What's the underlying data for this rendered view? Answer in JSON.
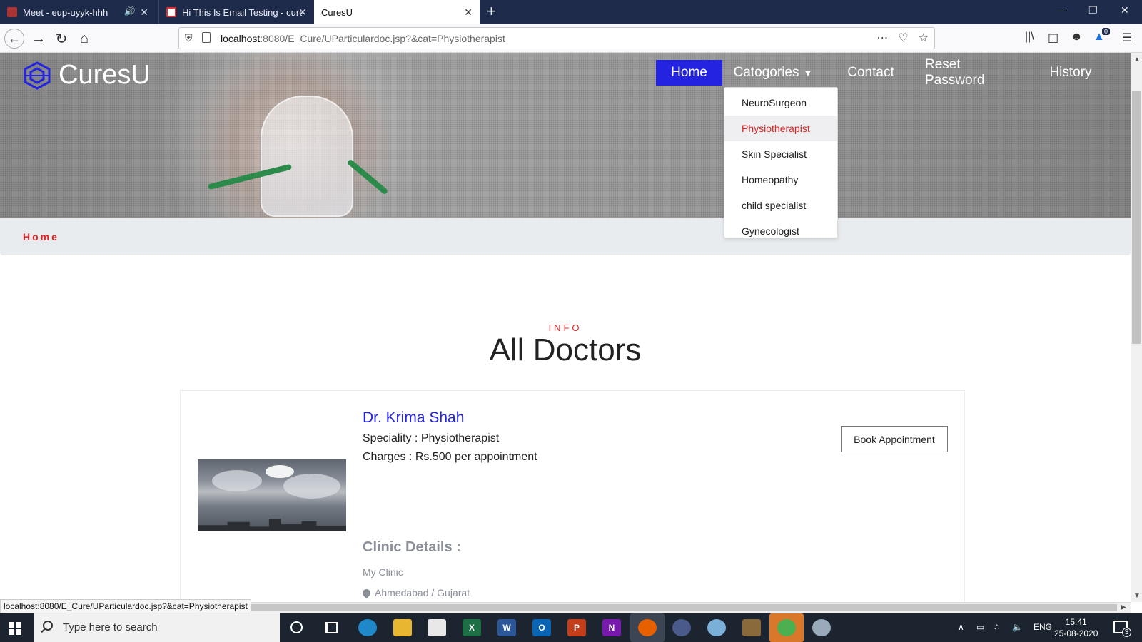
{
  "browser": {
    "tabs": [
      {
        "title": "Meet - eup-uyyk-hhh"
      },
      {
        "title": "Hi This Is Email Testing - curesu"
      },
      {
        "title": "CuresU"
      }
    ],
    "url_host": "localhost",
    "url_rest": ":8080/E_Cure/UParticulardoc.jsp?&cat=Physiotherapist",
    "notification_count": "0",
    "status_url": "localhost:8080/E_Cure/UParticulardoc.jsp?&cat=Physiotherapist"
  },
  "site": {
    "brand": "CuresU",
    "nav": {
      "home": "Home",
      "categories": "Catogories",
      "contact": "Contact",
      "reset_password": "Reset Password",
      "history": "History"
    },
    "categories": [
      {
        "label": "NeuroSurgeon"
      },
      {
        "label": "Physiotherapist"
      },
      {
        "label": "Skin Specialist"
      },
      {
        "label": "Homeopathy"
      },
      {
        "label": "child specialist"
      },
      {
        "label": "Gynecologist"
      }
    ],
    "active_category": "Physiotherapist",
    "breadcrumb": "Home",
    "section_tag": "INFO",
    "section_title": "All Doctors",
    "doctor": {
      "name": "Dr. Krima Shah",
      "speciality": "Speciality : Physiotherapist",
      "charges": "Charges : Rs.500 per appointment",
      "book_label": "Book Appointment",
      "clinic_heading": "Clinic Details :",
      "clinic_name": "My Clinic",
      "clinic_location": "Ahmedabad / Gujarat"
    },
    "colors": {
      "accent_blue": "#2424e0",
      "accent_red": "#e02424"
    }
  },
  "taskbar": {
    "search_placeholder": "Type here to search",
    "language": "ENG",
    "time": "15:41",
    "date": "25-08-2020",
    "notifications": "3"
  }
}
